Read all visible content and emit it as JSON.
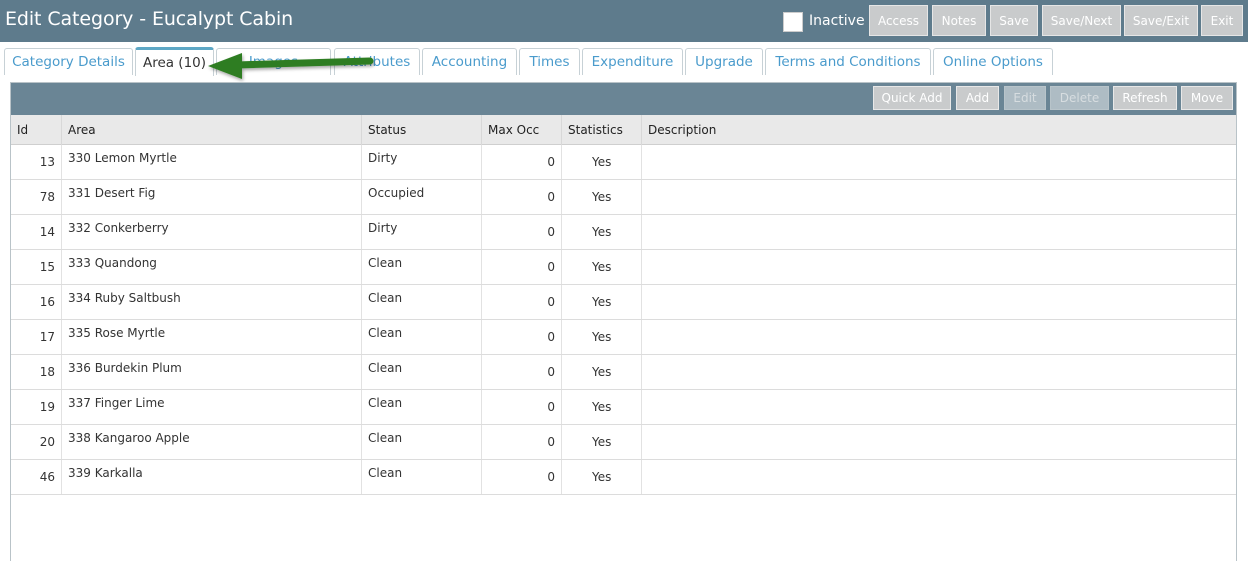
{
  "header": {
    "title": "Edit Category - Eucalypt Cabin",
    "inactive_label": "Inactive",
    "buttons": [
      "Access",
      "Notes",
      "Save",
      "Save/Next",
      "Save/Exit",
      "Exit"
    ]
  },
  "tabs": [
    {
      "label": "Category Details"
    },
    {
      "label": "Area (10)"
    },
    {
      "label": "Images"
    },
    {
      "label": "Attributes"
    },
    {
      "label": "Accounting"
    },
    {
      "label": "Times"
    },
    {
      "label": "Expenditure"
    },
    {
      "label": "Upgrade"
    },
    {
      "label": "Terms and Conditions"
    },
    {
      "label": "Online Options"
    }
  ],
  "active_tab": "Area (10)",
  "toolbar": {
    "buttons": [
      "Quick Add",
      "Add",
      "Edit",
      "Delete",
      "Refresh",
      "Move"
    ],
    "disabled": [
      "Edit",
      "Delete"
    ]
  },
  "grid": {
    "columns": [
      "Id",
      "Area",
      "Status",
      "Max Occ",
      "Statistics",
      "Description"
    ],
    "rows": [
      {
        "id": "13",
        "area": "330 Lemon Myrtle",
        "status": "Dirty",
        "max_occ": "0",
        "statistics": "Yes",
        "description": ""
      },
      {
        "id": "78",
        "area": "331 Desert Fig",
        "status": "Occupied",
        "max_occ": "0",
        "statistics": "Yes",
        "description": ""
      },
      {
        "id": "14",
        "area": "332 Conkerberry",
        "status": "Dirty",
        "max_occ": "0",
        "statistics": "Yes",
        "description": ""
      },
      {
        "id": "15",
        "area": "333 Quandong",
        "status": "Clean",
        "max_occ": "0",
        "statistics": "Yes",
        "description": ""
      },
      {
        "id": "16",
        "area": "334 Ruby Saltbush",
        "status": "Clean",
        "max_occ": "0",
        "statistics": "Yes",
        "description": ""
      },
      {
        "id": "17",
        "area": "335 Rose Myrtle",
        "status": "Clean",
        "max_occ": "0",
        "statistics": "Yes",
        "description": ""
      },
      {
        "id": "18",
        "area": "336 Burdekin Plum",
        "status": "Clean",
        "max_occ": "0",
        "statistics": "Yes",
        "description": ""
      },
      {
        "id": "19",
        "area": "337 Finger Lime",
        "status": "Clean",
        "max_occ": "0",
        "statistics": "Yes",
        "description": ""
      },
      {
        "id": "20",
        "area": "338 Kangaroo Apple",
        "status": "Clean",
        "max_occ": "0",
        "statistics": "Yes",
        "description": ""
      },
      {
        "id": "46",
        "area": "339 Karkalla",
        "status": "Clean",
        "max_occ": "0",
        "statistics": "Yes",
        "description": ""
      }
    ]
  },
  "colors": {
    "header": "#5e7b8c",
    "toolbar": "#6a8595",
    "tab_text": "#4a9bcc",
    "arrow": "#2e7d22"
  },
  "icons": {
    "annotation": "arrow-left-icon"
  }
}
